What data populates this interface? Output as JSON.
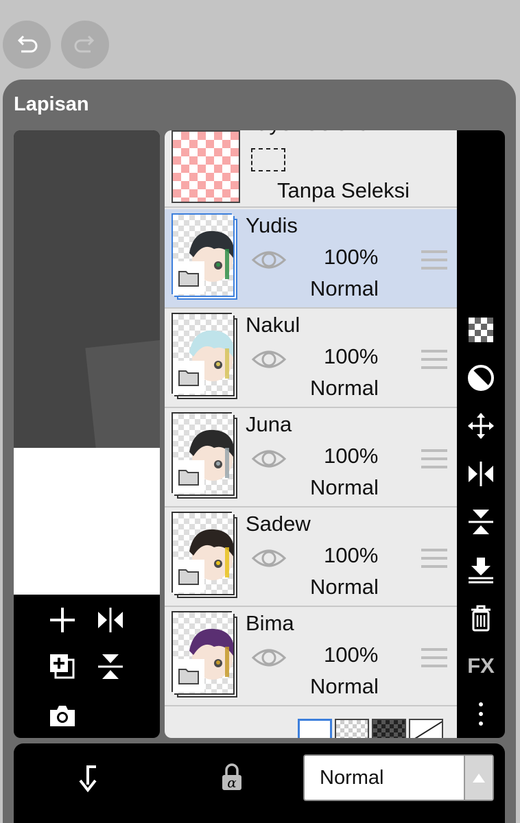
{
  "history": {
    "undo_icon": "undo-arrow-icon",
    "redo_icon": "redo-arrow-icon"
  },
  "panel": {
    "title": "Lapisan"
  },
  "selection_layer": {
    "name": "Layer Seleksi",
    "status": "Tanpa Seleksi"
  },
  "layers": [
    {
      "name": "Yudis",
      "opacity": "100%",
      "blend": "Normal",
      "selected": true,
      "hair": "#2d3237",
      "accent": "#2f8f4a"
    },
    {
      "name": "Nakul",
      "opacity": "100%",
      "blend": "Normal",
      "selected": false,
      "hair": "#bfe3ea",
      "accent": "#d6c35a"
    },
    {
      "name": "Juna",
      "opacity": "100%",
      "blend": "Normal",
      "selected": false,
      "hair": "#2a2a2a",
      "accent": "#9aa7ad"
    },
    {
      "name": "Sadew",
      "opacity": "100%",
      "blend": "Normal",
      "selected": false,
      "hair": "#2b2420",
      "accent": "#e8c21c"
    },
    {
      "name": "Bima",
      "opacity": "100%",
      "blend": "Normal",
      "selected": false,
      "hair": "#5a2f72",
      "accent": "#c49a2a"
    }
  ],
  "bottom_bar": {
    "blend_mode": "Normal",
    "clip_icon": "clipping-arrow-icon",
    "alpha_lock_icon": "alpha-lock-icon"
  },
  "colors": {
    "selected_row": "#cfdaee",
    "accent_blue": "#3d7fdc",
    "panel": "#6b6b6b",
    "background": "#c4c4c4"
  }
}
